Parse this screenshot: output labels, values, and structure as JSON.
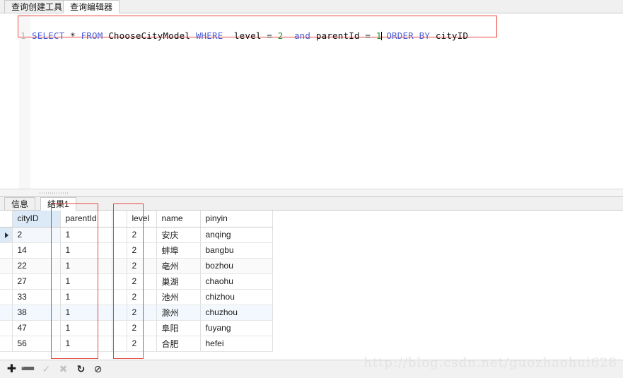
{
  "window": {
    "tabs": [
      {
        "id": "builder",
        "label": "查询创建工具",
        "active": false
      },
      {
        "id": "editor",
        "label": "查询编辑器",
        "active": true
      }
    ]
  },
  "editor": {
    "line_number": "1",
    "sql_full": "SELECT * FROM ChooseCityModel WHERE  level = 2  and parentId = 1 ORDER BY cityID",
    "tokens": [
      {
        "text": "SELECT",
        "kind": "keyword"
      },
      {
        "text": " ",
        "kind": "plain"
      },
      {
        "text": "*",
        "kind": "operator"
      },
      {
        "text": " ",
        "kind": "plain"
      },
      {
        "text": "FROM",
        "kind": "keyword"
      },
      {
        "text": " ",
        "kind": "plain"
      },
      {
        "text": "ChooseCityModel",
        "kind": "identifier"
      },
      {
        "text": " ",
        "kind": "plain"
      },
      {
        "text": "WHERE",
        "kind": "keyword"
      },
      {
        "text": "  ",
        "kind": "plain"
      },
      {
        "text": "level",
        "kind": "identifier"
      },
      {
        "text": " = ",
        "kind": "operator"
      },
      {
        "text": "2",
        "kind": "number"
      },
      {
        "text": "  ",
        "kind": "plain"
      },
      {
        "text": "and",
        "kind": "keyword"
      },
      {
        "text": " ",
        "kind": "plain"
      },
      {
        "text": "parentId",
        "kind": "identifier"
      },
      {
        "text": " = ",
        "kind": "operator"
      },
      {
        "text": "1",
        "kind": "number"
      },
      {
        "text": "CARET",
        "kind": "caret"
      },
      {
        "text": " ",
        "kind": "plain"
      },
      {
        "text": "ORDER BY",
        "kind": "keyword"
      },
      {
        "text": " ",
        "kind": "plain"
      },
      {
        "text": "cityID",
        "kind": "identifier"
      }
    ],
    "colors": {
      "keyword": "#4c5fd7",
      "number": "#2f8f2f",
      "identifier": "#111111",
      "annotation": "#e8473f"
    }
  },
  "results": {
    "tabs": [
      {
        "id": "info",
        "label": "信息",
        "active": false
      },
      {
        "id": "result",
        "label": "结果1",
        "active": true
      }
    ],
    "columns": [
      {
        "key": "cityID",
        "label": "cityID",
        "selected": true
      },
      {
        "key": "parentId",
        "label": "parentId",
        "selected": false
      },
      {
        "key": "level",
        "label": "level",
        "selected": false
      },
      {
        "key": "name",
        "label": "name",
        "selected": false
      },
      {
        "key": "pinyin",
        "label": "pinyin",
        "selected": false
      }
    ],
    "rows": [
      {
        "cityID": "2",
        "parentId": "1",
        "level": "2",
        "name": "安庆",
        "pinyin": "anqing"
      },
      {
        "cityID": "14",
        "parentId": "1",
        "level": "2",
        "name": "蚌埠",
        "pinyin": "bangbu"
      },
      {
        "cityID": "22",
        "parentId": "1",
        "level": "2",
        "name": "亳州",
        "pinyin": "bozhou"
      },
      {
        "cityID": "27",
        "parentId": "1",
        "level": "2",
        "name": "巢湖",
        "pinyin": "chaohu"
      },
      {
        "cityID": "33",
        "parentId": "1",
        "level": "2",
        "name": "池州",
        "pinyin": "chizhou"
      },
      {
        "cityID": "38",
        "parentId": "1",
        "level": "2",
        "name": "滁州",
        "pinyin": "chuzhou"
      },
      {
        "cityID": "47",
        "parentId": "1",
        "level": "2",
        "name": "阜阳",
        "pinyin": "fuyang"
      },
      {
        "cityID": "56",
        "parentId": "1",
        "level": "2",
        "name": "合肥",
        "pinyin": "hefei"
      }
    ],
    "current_row_index": 0,
    "row_marker_glyph": "▶"
  },
  "annotations": [
    {
      "id": "parentid",
      "target": "parentId column"
    },
    {
      "id": "level",
      "target": "level column"
    }
  ],
  "toolbar": {
    "buttons": [
      {
        "id": "add",
        "glyph": "✚",
        "label": "添加记录",
        "enabled": true
      },
      {
        "id": "remove",
        "glyph": "➖",
        "label": "删除记录",
        "enabled": true
      },
      {
        "id": "confirm",
        "glyph": "✓",
        "label": "应用更改",
        "enabled": false
      },
      {
        "id": "cancel",
        "glyph": "✖",
        "label": "放弃更改",
        "enabled": false
      },
      {
        "id": "refresh",
        "glyph": "↻",
        "label": "刷新",
        "enabled": true
      },
      {
        "id": "stop",
        "glyph": "⊘",
        "label": "停止",
        "enabled": true
      }
    ]
  },
  "watermark": {
    "text": "http://blog.csdn.net/guozhaohui628"
  }
}
